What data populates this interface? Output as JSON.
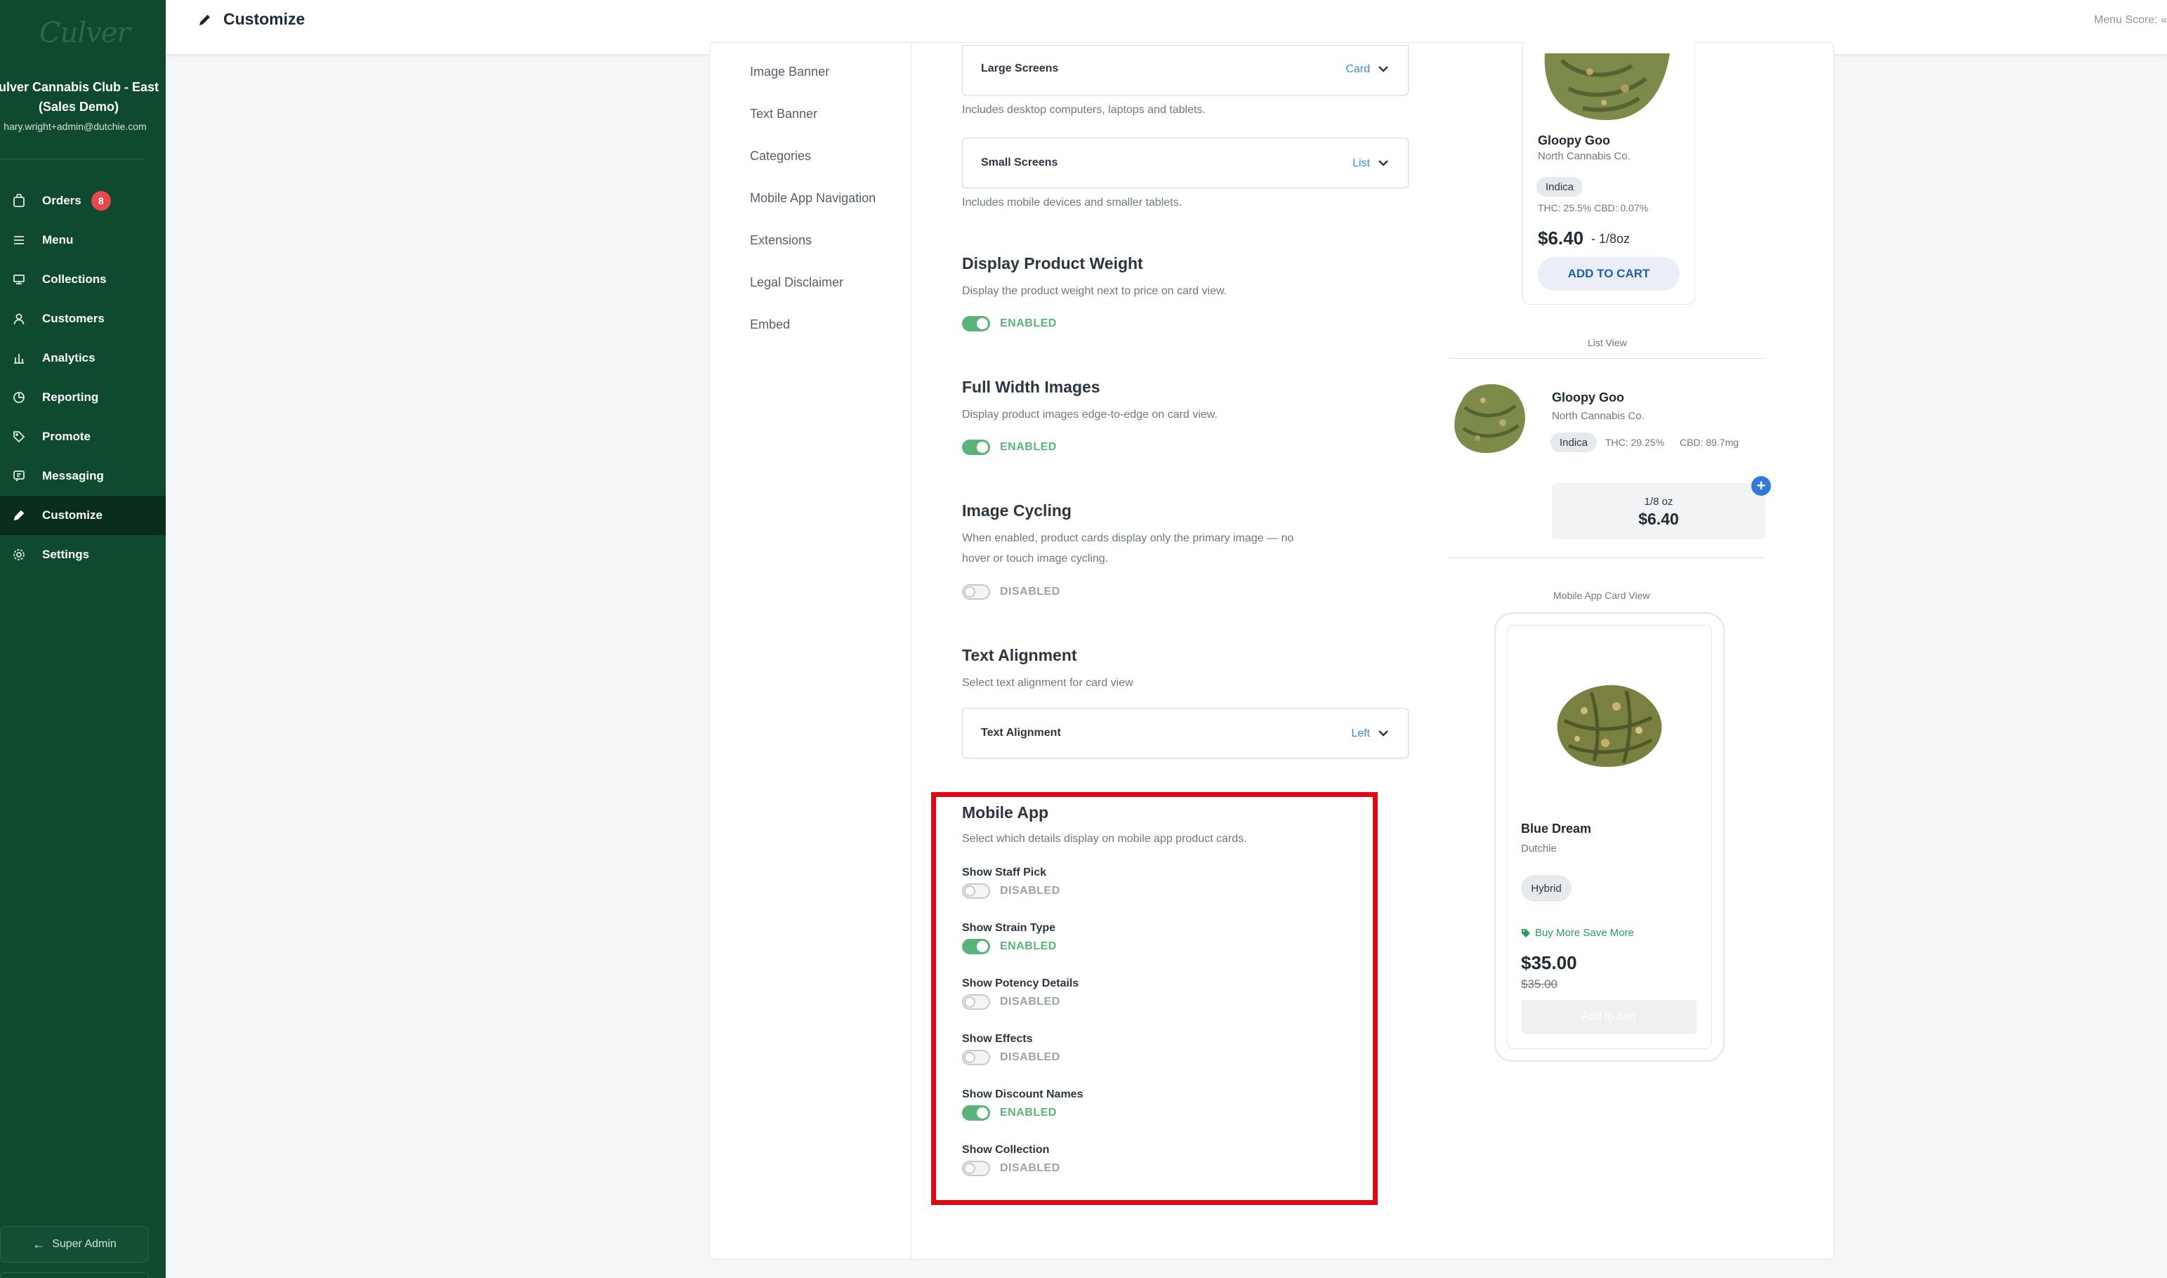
{
  "app": {
    "logo": "Culver",
    "store_name_line1": "ulver Cannabis Club - East",
    "store_name_line2": "(Sales Demo)",
    "email": "hary.wright+admin@dutchie.com",
    "menu_score": "Menu Score: «"
  },
  "sidebar": {
    "items": [
      {
        "label": "Orders",
        "icon": "bag-icon",
        "badge": "8"
      },
      {
        "label": "Menu",
        "icon": "menu-lines-icon"
      },
      {
        "label": "Collections",
        "icon": "collections-icon"
      },
      {
        "label": "Customers",
        "icon": "user-icon"
      },
      {
        "label": "Analytics",
        "icon": "bar-chart-icon"
      },
      {
        "label": "Reporting",
        "icon": "reporting-icon"
      },
      {
        "label": "Promote",
        "icon": "tag-icon"
      },
      {
        "label": "Messaging",
        "icon": "message-icon"
      },
      {
        "label": "Customize",
        "icon": "pencil-icon",
        "active": true
      },
      {
        "label": "Settings",
        "icon": "gear-icon"
      }
    ],
    "super_admin": "Super Admin"
  },
  "header": {
    "title": "Customize"
  },
  "subnav": {
    "items": [
      "Image Banner",
      "Text Banner",
      "Categories",
      "Mobile App Navigation",
      "Extensions",
      "Legal Disclaimer",
      "Embed"
    ]
  },
  "settings": {
    "large_screens": {
      "label": "Large Screens",
      "value": "Card",
      "help": "Includes desktop computers, laptops and tablets."
    },
    "small_screens": {
      "label": "Small Screens",
      "value": "List",
      "help": "Includes mobile devices and smaller tablets."
    },
    "product_weight": {
      "title": "Display Product Weight",
      "desc": "Display the product weight next to price on card view.",
      "state": "ENABLED"
    },
    "full_width": {
      "title": "Full Width Images",
      "desc": "Display product images edge-to-edge on card view.",
      "state": "ENABLED"
    },
    "image_cycling": {
      "title": "Image Cycling",
      "desc_line1": "When enabled, product cards display only the primary image — no",
      "desc_line2": "hover or touch image cycling.",
      "state": "DISABLED"
    },
    "text_alignment": {
      "title": "Text Alignment",
      "desc": "Select text alignment for card view",
      "label": "Text Alignment",
      "value": "Left"
    },
    "mobile_app": {
      "title": "Mobile App",
      "desc": "Select which details display on mobile app product cards.",
      "options": [
        {
          "label": "Show Staff Pick",
          "state": "DISABLED"
        },
        {
          "label": "Show Strain Type",
          "state": "ENABLED"
        },
        {
          "label": "Show Potency Details",
          "state": "DISABLED"
        },
        {
          "label": "Show Effects",
          "state": "DISABLED"
        },
        {
          "label": "Show Discount Names",
          "state": "ENABLED"
        },
        {
          "label": "Show Collection",
          "state": "DISABLED"
        }
      ]
    }
  },
  "preview": {
    "card": {
      "name": "Gloopy Goo",
      "brand": "North Cannabis Co.",
      "strain": "Indica",
      "potency": "THC: 25.5%  CBD: 0.07%",
      "price": "$6.40",
      "unit": "- 1/8oz",
      "button": "ADD TO CART"
    },
    "list_view_label": "List View",
    "list": {
      "name": "Gloopy Goo",
      "brand": "North Cannabis Co.",
      "strain": "Indica",
      "thc": "THC: 29.25%",
      "cbd": "CBD: 89.7mg",
      "weight": "1/8 oz",
      "price": "$6.40",
      "plus": "+"
    },
    "mobile_label": "Mobile App Card View",
    "mobile": {
      "name": "Blue Dream",
      "brand": "Dutchie",
      "strain": "Hybrid",
      "promo": "Buy More Save More",
      "price": "$35.00",
      "original_price": "$35.00",
      "button": "Add to cart"
    }
  },
  "colors": {
    "sidebar_bg": "#0f4a2e",
    "active_nav": "#0b2d1c",
    "toggle_on": "#5bb37a",
    "link_blue": "#3c8fd6",
    "highlight_red": "#e30613",
    "badge_red": "#e5484d"
  }
}
